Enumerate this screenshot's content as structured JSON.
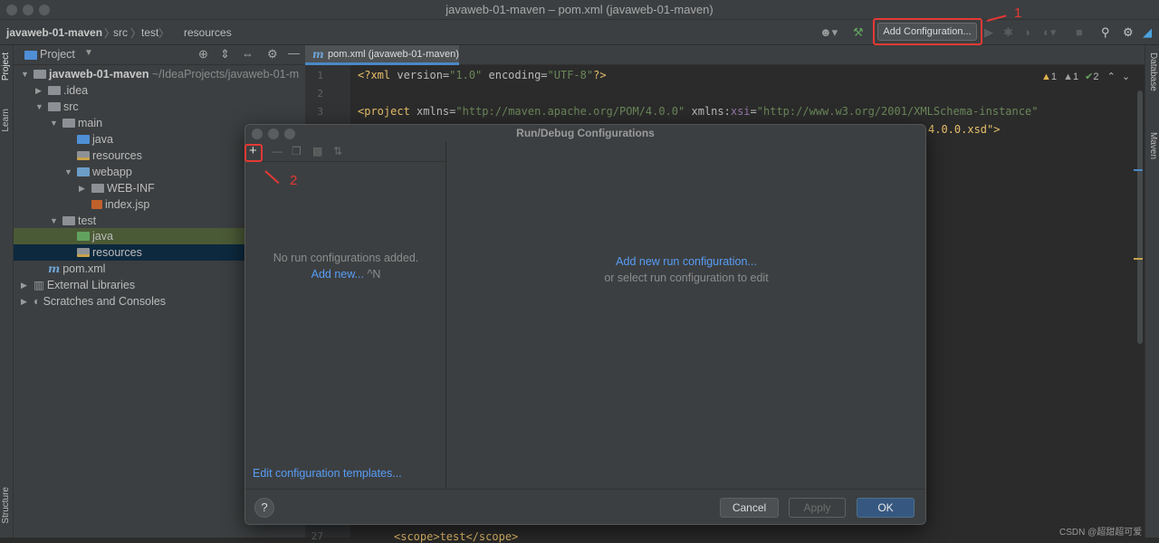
{
  "window": {
    "title": "javaweb-01-maven – pom.xml (javaweb-01-maven)"
  },
  "breadcrumbs": [
    "javaweb-01-maven",
    "src",
    "test",
    "resources"
  ],
  "toolbar": {
    "add_config_label": "Add Configuration..."
  },
  "annotations": [
    "1",
    "2"
  ],
  "sidebar_left": {
    "project": "Project",
    "learn": "Learn",
    "structure": "Structure"
  },
  "sidebar_right": {
    "database": "Database",
    "maven": "Maven"
  },
  "project_panel": {
    "title": "Project",
    "root_name": "javaweb-01-maven",
    "root_path": "~/IdeaProjects/javaweb-01-m",
    "items": [
      ".idea",
      "src",
      "main",
      "java",
      "resources",
      "webapp",
      "WEB-INF",
      "index.jsp",
      "test",
      "java",
      "resources",
      "pom.xml",
      "External Libraries",
      "Scratches and Consoles"
    ]
  },
  "editor": {
    "tab": "pom.xml (javaweb-01-maven)",
    "inspection": {
      "warn1": "1",
      "warn2": "1",
      "ok": "2"
    },
    "line_numbers": [
      "1",
      "2",
      "3",
      "27"
    ],
    "lines": {
      "l1_decl": "<?xml ",
      "l1_version_attr": "version=",
      "l1_version_val": "\"1.0\"",
      "l1_enc_attr": " encoding=",
      "l1_enc_val": "\"UTF-8\"",
      "l1_end": "?>",
      "l3_tag": "<project ",
      "l3_xmlns_attr": "xmlns=",
      "l3_xmlns_val": "\"http://maven.apache.org/POM/4.0.0\"",
      "l3_xsi_attr": " xmlns:",
      "l3_xsi_ns": "xsi",
      "l3_xsi_eq": "=",
      "l3_xsi_val": "\"http://www.w3.org/2001/XMLSchema-instance\"",
      "l4_tail": "4.0.0.xsd\">",
      "l27": "<scope>test</scope>"
    }
  },
  "dialog": {
    "title": "Run/Debug Configurations",
    "empty_text": "No run configurations added.",
    "add_new": "Add new...",
    "add_new_shortcut": "^N",
    "right_link": "Add new run configuration...",
    "right_text": "or select run configuration to edit",
    "templates_link": "Edit configuration templates...",
    "help": "?",
    "cancel": "Cancel",
    "apply": "Apply",
    "ok": "OK"
  },
  "watermark": "CSDN @超甜超可爱",
  "colors": {
    "accent": "#4a88c7",
    "annotation": "#e53935",
    "ok_button": "#365880",
    "link": "#589df6"
  }
}
